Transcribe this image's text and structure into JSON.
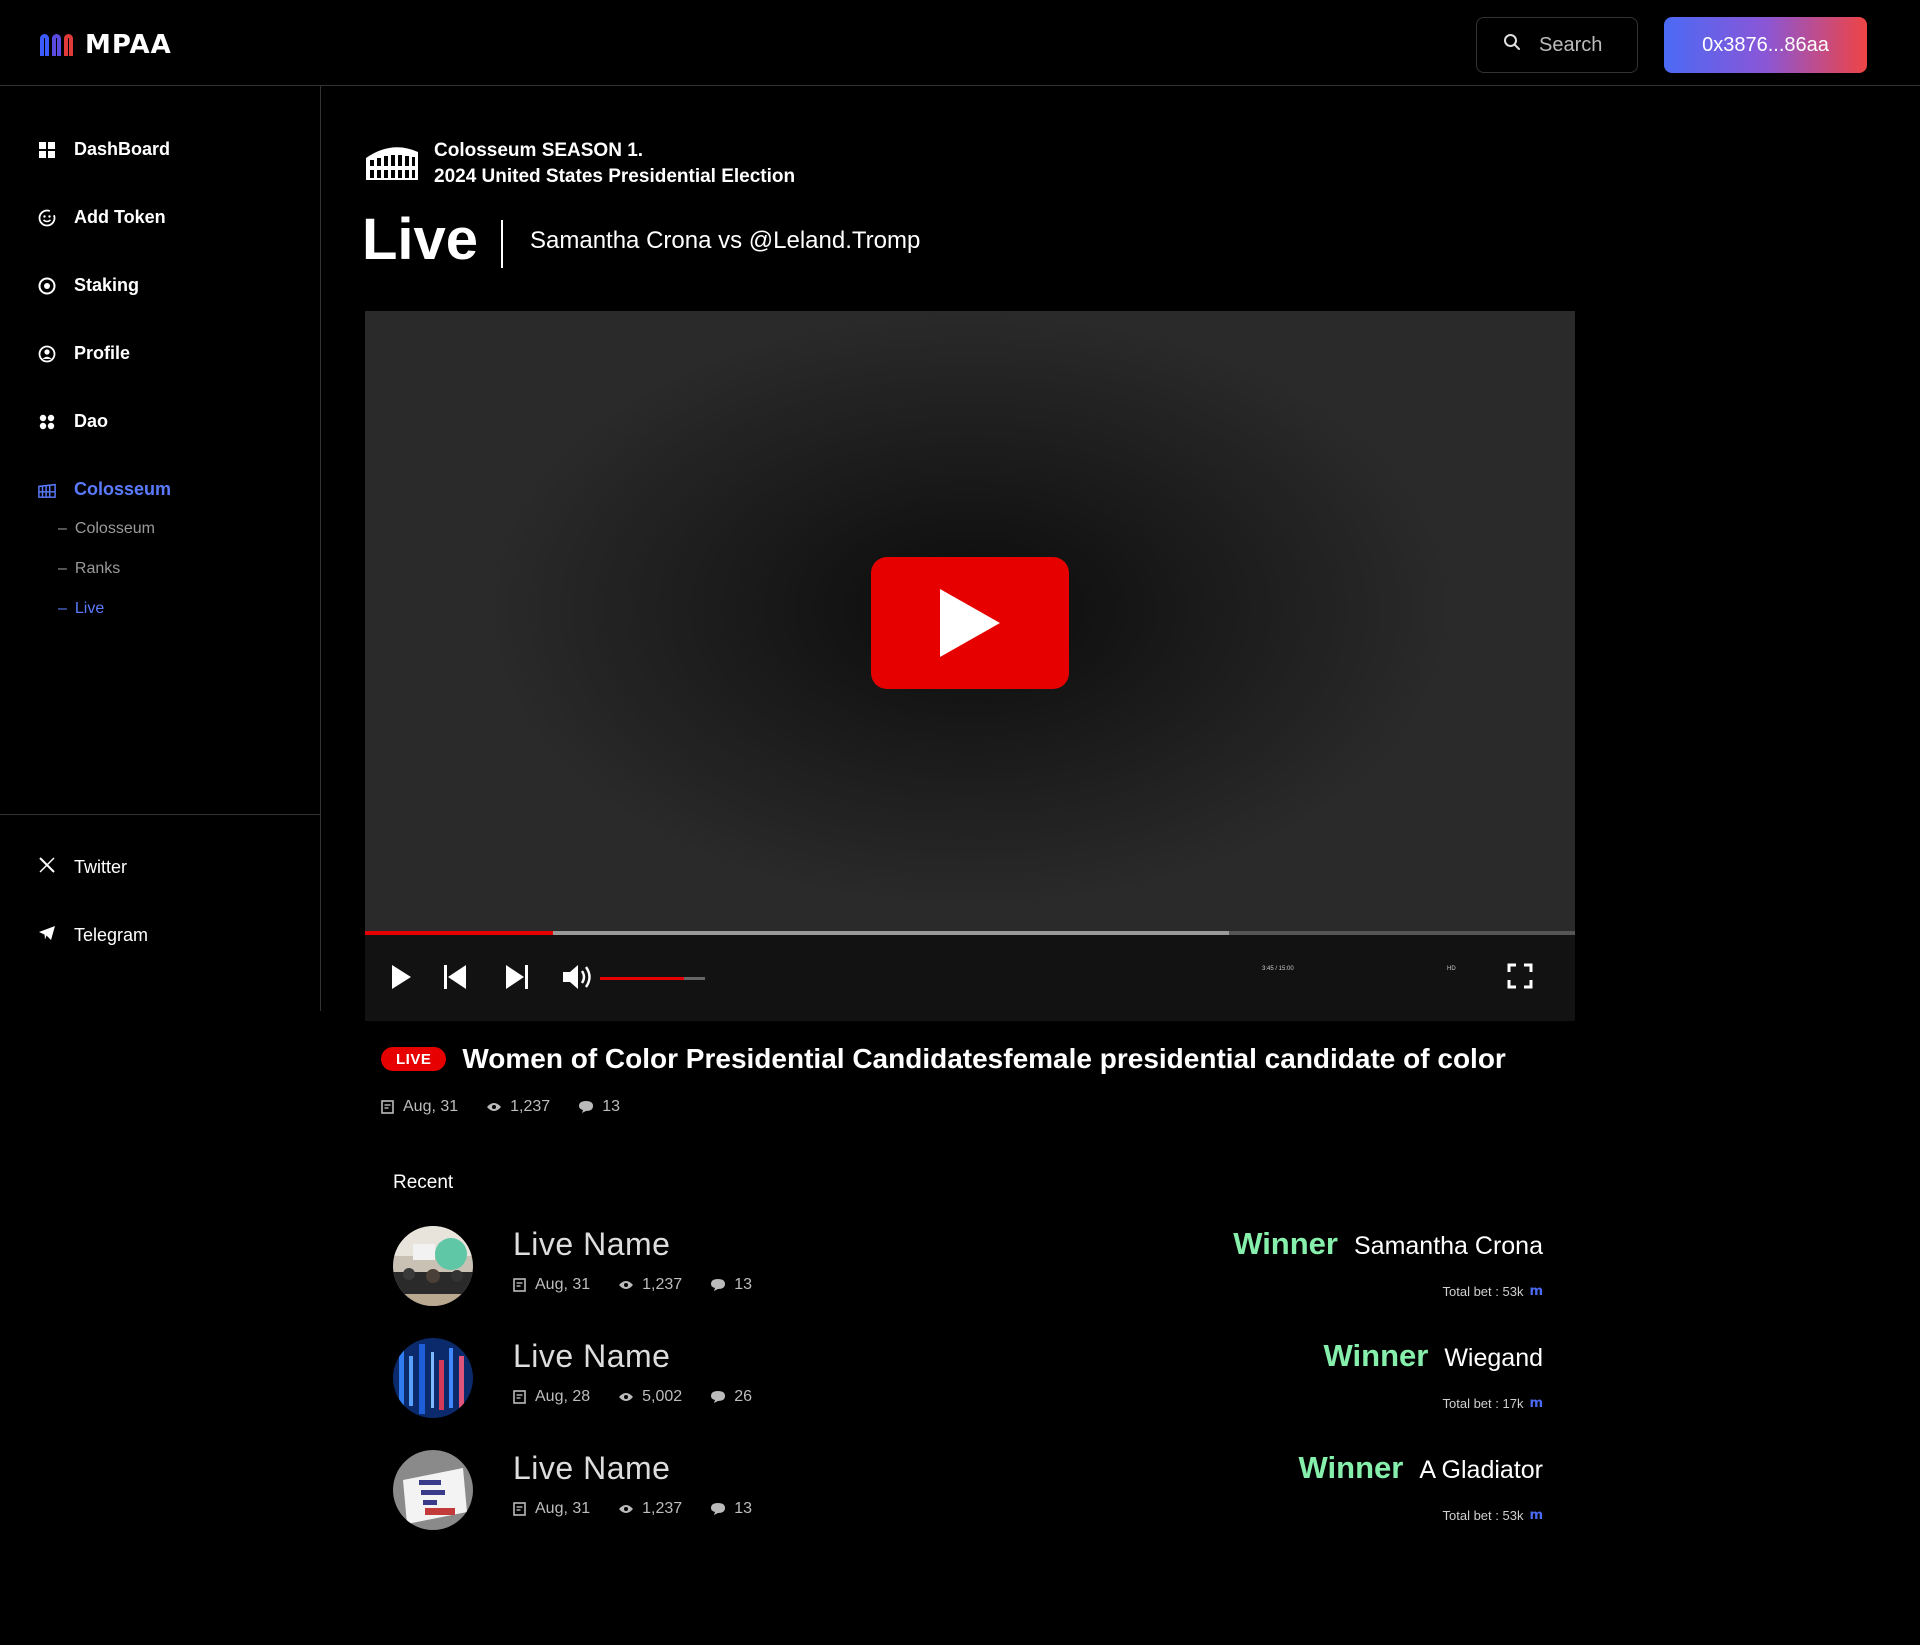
{
  "header": {
    "logo_text": "MPAA",
    "search_placeholder": "Search",
    "wallet_label": "0x3876...86aa"
  },
  "sidebar": {
    "items": [
      {
        "label": "DashBoard",
        "icon": "grid-icon"
      },
      {
        "label": "Add Token",
        "icon": "smiley-icon"
      },
      {
        "label": "Staking",
        "icon": "coin-icon"
      },
      {
        "label": "Profile",
        "icon": "user-circle-icon"
      },
      {
        "label": "Dao",
        "icon": "dots-icon"
      },
      {
        "label": "Colosseum",
        "icon": "colosseum-icon",
        "active": true
      }
    ],
    "subitems": [
      {
        "label": "Colosseum"
      },
      {
        "label": "Ranks"
      },
      {
        "label": "Live",
        "active": true
      }
    ],
    "social": [
      {
        "label": "Twitter",
        "icon": "x-icon"
      },
      {
        "label": "Telegram",
        "icon": "telegram-icon"
      }
    ]
  },
  "page": {
    "season_line1": "Colosseum SEASON 1.",
    "season_line2": "2024 United States Presidential Election",
    "title": "Live",
    "matchup": "Samantha Crona vs @Leland.Tromp"
  },
  "player": {
    "progress_played": 0.155,
    "progress_buffered": 0.714,
    "volume": 0.8,
    "time_text": "3:45 / 15:00",
    "quality_text": "HD"
  },
  "video": {
    "badge": "LIVE",
    "title": "Women of Color Presidential Candidatesfemale presidential candidate of color",
    "date": "Aug, 31",
    "views": "1,237",
    "comments": "13"
  },
  "recent": {
    "label": "Recent",
    "items": [
      {
        "name": "Live Name",
        "date": "Aug, 31",
        "views": "1,237",
        "comments": "13",
        "winner_label": "Winner",
        "winner": "Samantha Crona",
        "total_bet": "Total bet : 53k"
      },
      {
        "name": "Live Name",
        "date": "Aug, 28",
        "views": "5,002",
        "comments": "26",
        "winner_label": "Winner",
        "winner": "Wiegand",
        "total_bet": "Total bet : 17k"
      },
      {
        "name": "Live Name",
        "date": "Aug, 31",
        "views": "1,237",
        "comments": "13",
        "winner_label": "Winner",
        "winner": "A Gladiator",
        "total_bet": "Total bet : 53k"
      }
    ]
  },
  "colors": {
    "accent": "#5b7bff",
    "live_red": "#e60000",
    "winner_green": "#86efac"
  }
}
